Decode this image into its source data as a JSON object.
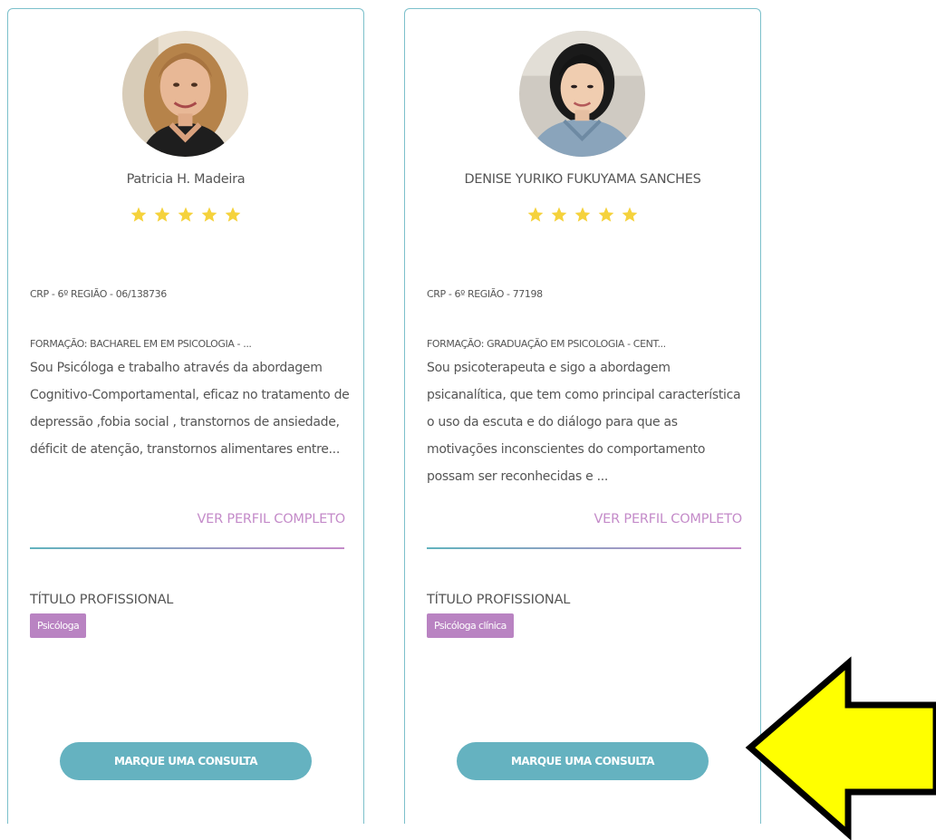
{
  "colors": {
    "card_border": "#7cc0cb",
    "accent_teal": "#65b2c0",
    "accent_purple": "#c48bc9",
    "badge_bg": "#b983c2",
    "star": "#f5d23c",
    "arrow_fill": "#ffff00"
  },
  "cards": [
    {
      "avatar_icon": "profile-photo",
      "name": "Patricia H. Madeira",
      "rating": 5,
      "crp": "CRP - 6º REGIÃO - 06/138736",
      "formacao": "FORMAÇÃO: BACHAREL EM EM PSICOLOGIA - ...",
      "bio": "Sou Psicóloga e trabalho através da abordagem Cognitivo-Comportamental, eficaz no tratamento de depressão ,fobia social , transtornos de ansiedade, déficit de atenção, transtornos alimentares entre...",
      "ver_perfil": "VER PERFIL COMPLETO",
      "titulo_label": "TÍTULO PROFISSIONAL",
      "badge": "Psicóloga",
      "button": "MARQUE UMA CONSULTA"
    },
    {
      "avatar_icon": "profile-photo",
      "name": "DENISE YURIKO FUKUYAMA SANCHES",
      "rating": 5,
      "crp": "CRP - 6º REGIÃO - 77198",
      "formacao": "FORMAÇÃO: GRADUAÇÃO EM PSICOLOGIA - CENT...",
      "bio": "Sou psicoterapeuta e sigo a abordagem psicanalítica, que tem como principal característica o uso da escuta e do diálogo para que as motivações inconscientes do comportamento possam ser reconhecidas e ...",
      "ver_perfil": "VER PERFIL COMPLETO",
      "titulo_label": "TÍTULO PROFISSIONAL",
      "badge": "Psicóloga clínica",
      "button": "MARQUE UMA CONSULTA"
    }
  ],
  "annotation": {
    "icon": "yellow-arrow-left-icon"
  }
}
